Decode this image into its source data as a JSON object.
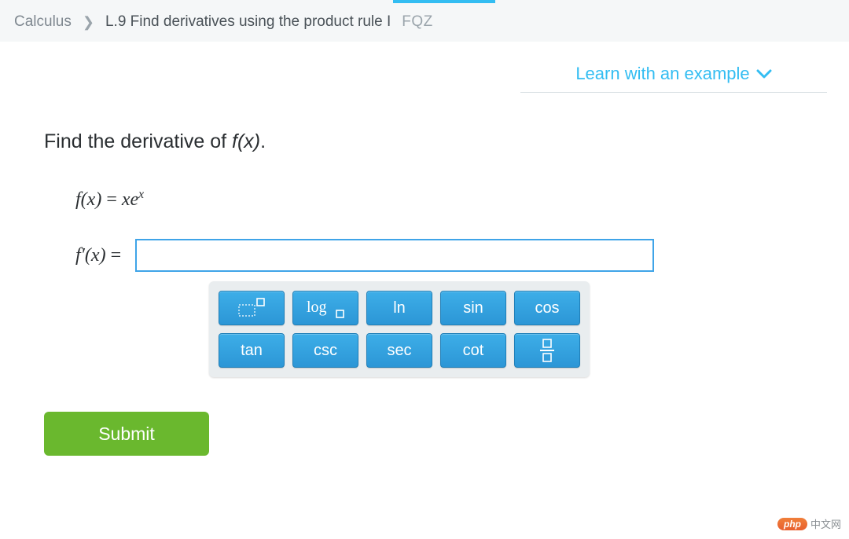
{
  "breadcrumb": {
    "subject": "Calculus",
    "lesson": "L.9 Find derivatives using the product rule I",
    "code": "FQZ"
  },
  "learn_link": "Learn with an example",
  "prompt_prefix": "Find the derivative of ",
  "prompt_fx": "f(x)",
  "prompt_suffix": ".",
  "equation": {
    "lhs": "f(x)",
    "eq": " = ",
    "rhs_base": "xe",
    "rhs_exp": "x"
  },
  "answer": {
    "lhs": "f′(x)",
    "eq": " = ",
    "value": ""
  },
  "keypad": {
    "rows": [
      [
        "exponent",
        "log",
        "ln",
        "sin",
        "cos"
      ],
      [
        "tan",
        "csc",
        "sec",
        "cot",
        "fraction"
      ]
    ],
    "labels": {
      "ln": "ln",
      "sin": "sin",
      "cos": "cos",
      "tan": "tan",
      "csc": "csc",
      "sec": "sec",
      "cot": "cot"
    }
  },
  "submit": "Submit",
  "watermark": {
    "badge": "php",
    "text": "中文网"
  }
}
